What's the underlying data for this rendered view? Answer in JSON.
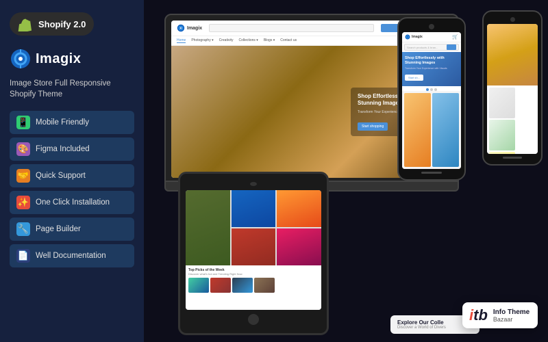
{
  "left": {
    "badge": {
      "label": "Shopify 2.0"
    },
    "brand": {
      "name": "Imagix",
      "description": "Image Store Full Responsive Shopify Theme"
    },
    "features": [
      {
        "id": "mobile-friendly",
        "label": "Mobile Friendly",
        "icon": "📱",
        "color": "icon-green"
      },
      {
        "id": "figma-included",
        "label": "Figma Included",
        "icon": "🎨",
        "color": "icon-purple"
      },
      {
        "id": "quick-support",
        "label": "Quick Support",
        "icon": "🤝",
        "color": "icon-orange"
      },
      {
        "id": "one-click",
        "label": "One Click Installation",
        "icon": "✨",
        "color": "icon-red"
      },
      {
        "id": "page-builder",
        "label": "Page Builder",
        "icon": "🔧",
        "color": "icon-blue"
      },
      {
        "id": "documentation",
        "label": "Well Documentation",
        "icon": "📄",
        "color": "icon-darkblue"
      }
    ]
  },
  "right": {
    "website": {
      "logo": "Imagix",
      "search_placeholder": "Search products & brands",
      "search_btn": "Search",
      "nav": [
        "Home",
        "Photography ▾",
        "Creativity",
        "Collections ▾",
        "Blogs ▾",
        "Contact us"
      ],
      "hero_title": "Shop Effortlessly with Stunning Images",
      "hero_subtitle": "Transform Your Experience with Captivating Visuals",
      "hero_btn": "Start shopping"
    },
    "tablet": {
      "bottom_title": "Top Picks of the Week",
      "bottom_sub": "Discover what's hot and Trending Right Now"
    },
    "mobile": {
      "logo": "Imagix",
      "search_placeholder": "Search products & bran...",
      "hero_title": "Shop Effortlessly with Stunning Images",
      "hero_sub": "Transform Your Experience with Visuals",
      "hero_btn": "Start sh..."
    },
    "itb": {
      "logo": "itb",
      "title": "Info Theme",
      "subtitle": "Bazaar"
    },
    "explore": {
      "title": "Explore Our Colle",
      "subtitle": "Discover a World of Divers"
    }
  }
}
